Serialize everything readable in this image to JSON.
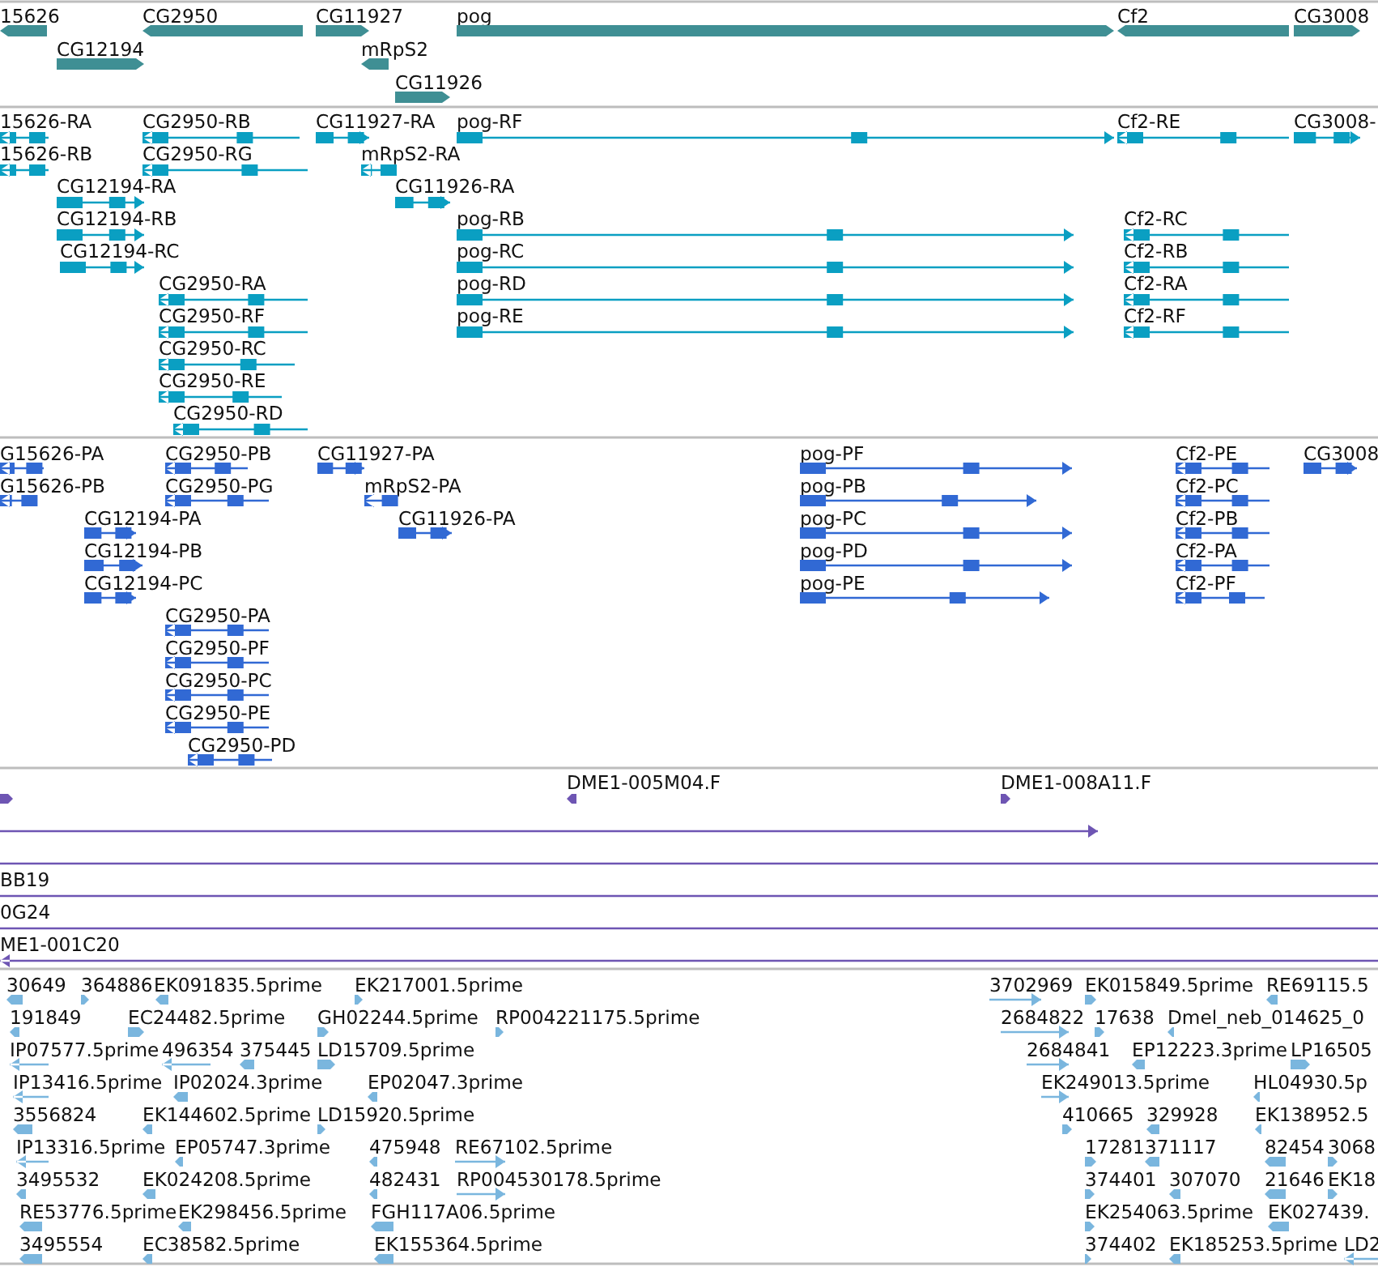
{
  "tracks": [
    {
      "kind": "gene",
      "features": [
        {
          "label": "15626",
          "reverse": true
        },
        {
          "label": "CG2950",
          "reverse": true
        },
        {
          "label": "CG11927",
          "reverse": false
        },
        {
          "label": "pog",
          "reverse": false
        },
        {
          "label": "Cf2",
          "reverse": true
        },
        {
          "label": "CG3008",
          "reverse": false
        },
        {
          "label": "CG12194",
          "reverse": false
        },
        {
          "label": "mRpS2",
          "reverse": true
        },
        {
          "label": "CG11926",
          "reverse": false
        }
      ]
    },
    {
      "kind": "transcript",
      "features": [
        {
          "label": "15626-RA",
          "reverse": true
        },
        {
          "label": "CG2950-RB",
          "reverse": true
        },
        {
          "label": "CG11927-RA",
          "reverse": false
        },
        {
          "label": "pog-RF",
          "reverse": false
        },
        {
          "label": "Cf2-RE",
          "reverse": true
        },
        {
          "label": "CG3008-",
          "reverse": false
        },
        {
          "label": "15626-RB",
          "reverse": true
        },
        {
          "label": "CG2950-RG",
          "reverse": true
        },
        {
          "label": "mRpS2-RA",
          "reverse": true
        },
        {
          "label": "CG12194-RA",
          "reverse": false
        },
        {
          "label": "CG11926-RA",
          "reverse": false
        },
        {
          "label": "CG12194-RB",
          "reverse": false
        },
        {
          "label": "pog-RB",
          "reverse": false
        },
        {
          "label": "Cf2-RC",
          "reverse": true
        },
        {
          "label": "CG12194-RC",
          "reverse": false
        },
        {
          "label": "pog-RC",
          "reverse": false
        },
        {
          "label": "Cf2-RB",
          "reverse": true
        },
        {
          "label": "CG2950-RA",
          "reverse": true
        },
        {
          "label": "pog-RD",
          "reverse": false
        },
        {
          "label": "Cf2-RA",
          "reverse": true
        },
        {
          "label": "CG2950-RF",
          "reverse": true
        },
        {
          "label": "pog-RE",
          "reverse": false
        },
        {
          "label": "Cf2-RF",
          "reverse": true
        },
        {
          "label": "CG2950-RC",
          "reverse": true
        },
        {
          "label": "CG2950-RE",
          "reverse": true
        },
        {
          "label": "CG2950-RD",
          "reverse": true
        }
      ]
    },
    {
      "kind": "protein",
      "features": [
        {
          "label": "G15626-PA",
          "reverse": true
        },
        {
          "label": "CG2950-PB",
          "reverse": true
        },
        {
          "label": "CG11927-PA",
          "reverse": false
        },
        {
          "label": "pog-PF",
          "reverse": false
        },
        {
          "label": "Cf2-PE",
          "reverse": true
        },
        {
          "label": "CG3008",
          "reverse": false
        },
        {
          "label": "G15626-PB",
          "reverse": true
        },
        {
          "label": "CG2950-PG",
          "reverse": true
        },
        {
          "label": "mRpS2-PA",
          "reverse": true
        },
        {
          "label": "pog-PB",
          "reverse": false
        },
        {
          "label": "Cf2-PC",
          "reverse": true
        },
        {
          "label": "CG12194-PA",
          "reverse": false
        },
        {
          "label": "CG11926-PA",
          "reverse": false
        },
        {
          "label": "pog-PC",
          "reverse": false
        },
        {
          "label": "Cf2-PB",
          "reverse": true
        },
        {
          "label": "CG12194-PB",
          "reverse": false
        },
        {
          "label": "pog-PD",
          "reverse": false
        },
        {
          "label": "Cf2-PA",
          "reverse": true
        },
        {
          "label": "CG12194-PC",
          "reverse": false
        },
        {
          "label": "pog-PE",
          "reverse": false
        },
        {
          "label": "Cf2-PF",
          "reverse": true
        },
        {
          "label": "CG2950-PA",
          "reverse": true
        },
        {
          "label": "CG2950-PF",
          "reverse": true
        },
        {
          "label": "CG2950-PC",
          "reverse": true
        },
        {
          "label": "CG2950-PE",
          "reverse": true
        },
        {
          "label": "CG2950-PD",
          "reverse": true
        }
      ]
    },
    {
      "kind": "clone",
      "features": [
        {
          "kind": "arrow",
          "reverse": false
        },
        {
          "kind": "arrow",
          "label": "DME1-005M04.F",
          "reverse": true
        },
        {
          "kind": "arrow",
          "label": "DME1-008A11.F",
          "reverse": false
        },
        {
          "kind": "arrow",
          "reverse": false
        },
        {
          "kind": "line"
        },
        {
          "kind": "line",
          "label": "BB19"
        },
        {
          "kind": "line",
          "label": "0G24"
        },
        {
          "kind": "arrow",
          "label": "ME1-001C20",
          "reverse": true
        }
      ]
    },
    {
      "kind": "est",
      "features": [
        {
          "label": "30649",
          "reverse": true
        },
        {
          "label": "364886",
          "reverse": false
        },
        {
          "label": "EK091835.5prime",
          "reverse": true
        },
        {
          "label": "EK217001.5prime",
          "reverse": false
        },
        {
          "label": "3702969",
          "reverse": false
        },
        {
          "label": "EK015849.5prime",
          "reverse": false
        },
        {
          "label": "RE69115.5",
          "reverse": true
        },
        {
          "label": "191849",
          "reverse": true
        },
        {
          "label": "EC24482.5prime",
          "reverse": false
        },
        {
          "label": "GH02244.5prime",
          "reverse": false
        },
        {
          "label": "RP004221175.5prime",
          "reverse": false
        },
        {
          "label": "2684822",
          "reverse": false
        },
        {
          "label": "17638",
          "reverse": false
        },
        {
          "label": "Dmel_neb_014625_0",
          "reverse": true
        },
        {
          "label": "IP07577.5prime",
          "reverse": true
        },
        {
          "label": "496354",
          "reverse": true
        },
        {
          "label": "375445",
          "reverse": true
        },
        {
          "label": "LD15709.5prime",
          "reverse": false
        },
        {
          "label": "2684841",
          "reverse": false
        },
        {
          "label": "EP12223.3prime",
          "reverse": true
        },
        {
          "label": "LP16505",
          "reverse": false
        },
        {
          "label": "IP13416.5prime",
          "reverse": true
        },
        {
          "label": "IP02024.3prime",
          "reverse": true
        },
        {
          "label": "EP02047.3prime",
          "reverse": true
        },
        {
          "label": "EK249013.5prime",
          "reverse": false
        },
        {
          "label": "HL04930.5p",
          "reverse": true
        },
        {
          "label": "3556824",
          "reverse": true
        },
        {
          "label": "EK144602.5prime",
          "reverse": true
        },
        {
          "label": "LD15920.5prime",
          "reverse": false
        },
        {
          "label": "410665",
          "reverse": false
        },
        {
          "label": "329928",
          "reverse": true
        },
        {
          "label": "EK138952.5",
          "reverse": true
        },
        {
          "label": "IP13316.5prime",
          "reverse": true
        },
        {
          "label": "EP05747.3prime",
          "reverse": true
        },
        {
          "label": "475948",
          "reverse": true
        },
        {
          "label": "RE67102.5prime",
          "reverse": false
        },
        {
          "label": "17281",
          "reverse": false
        },
        {
          "label": "371117",
          "reverse": true
        },
        {
          "label": "82454",
          "reverse": true
        },
        {
          "label": "3068",
          "reverse": false
        },
        {
          "label": "3495532",
          "reverse": true
        },
        {
          "label": "EK024208.5prime",
          "reverse": true
        },
        {
          "label": "482431",
          "reverse": true
        },
        {
          "label": "RP004530178.5prime",
          "reverse": false
        },
        {
          "label": "374401",
          "reverse": false
        },
        {
          "label": "307070",
          "reverse": true
        },
        {
          "label": "21646",
          "reverse": true
        },
        {
          "label": "EK18",
          "reverse": false
        },
        {
          "label": "RE53776.5prime",
          "reverse": true
        },
        {
          "label": "EK298456.5prime",
          "reverse": true
        },
        {
          "label": "FGH117A06.5prime",
          "reverse": true
        },
        {
          "label": "EK254063.5prime",
          "reverse": false
        },
        {
          "label": "EK027439.",
          "reverse": true
        },
        {
          "label": "3495554",
          "reverse": true
        },
        {
          "label": "EC38582.5prime",
          "reverse": true
        },
        {
          "label": "EK155364.5prime",
          "reverse": true
        },
        {
          "label": "374402",
          "reverse": false
        },
        {
          "label": "EK185253.5prime",
          "reverse": true
        },
        {
          "label": "LD2",
          "reverse": true
        }
      ]
    }
  ]
}
